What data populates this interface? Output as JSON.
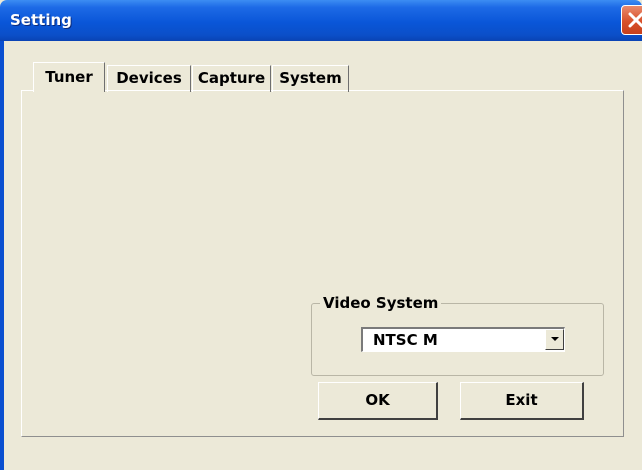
{
  "window": {
    "title": "Setting",
    "titlebar_color": "#0a56d8",
    "close_icon": "close-icon"
  },
  "tabs": [
    {
      "label": "Tuner",
      "active": true
    },
    {
      "label": "Devices",
      "active": false
    },
    {
      "label": "Capture",
      "active": false
    },
    {
      "label": "System",
      "active": false
    }
  ],
  "video_system": {
    "group_label": "Video System",
    "selected": "NTSC M",
    "dropdown_icon": "chevron-down-icon"
  },
  "buttons": {
    "ok_label": "OK",
    "exit_label": "Exit"
  }
}
